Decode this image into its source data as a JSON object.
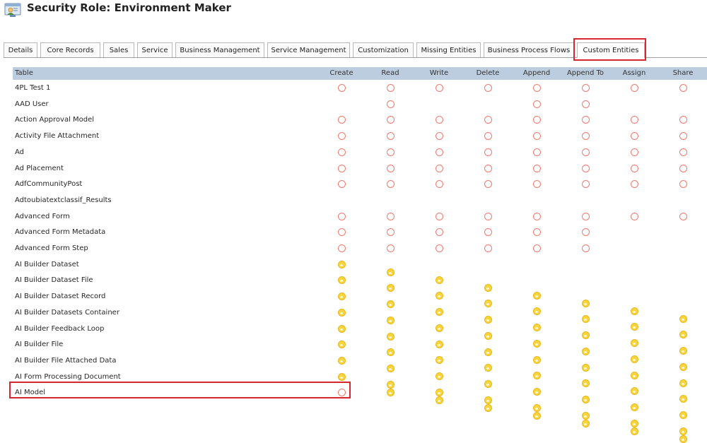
{
  "page": {
    "title": "Security Role: Environment Maker",
    "icon": "security-role-icon"
  },
  "tabs": [
    {
      "label": "Details",
      "active": false
    },
    {
      "label": "Core Records",
      "active": false
    },
    {
      "label": "Sales",
      "active": false
    },
    {
      "label": "Service",
      "active": false
    },
    {
      "label": "Business Management",
      "active": false
    },
    {
      "label": "Service Management",
      "active": false
    },
    {
      "label": "Customization",
      "active": false
    },
    {
      "label": "Missing Entities",
      "active": false
    },
    {
      "label": "Business Process Flows",
      "active": false
    },
    {
      "label": "Custom Entities",
      "active": true
    }
  ],
  "table": {
    "columns": [
      "Table",
      "Create",
      "Read",
      "Write",
      "Delete",
      "Append",
      "Append To",
      "Assign",
      "Share"
    ],
    "privilege_legend": {
      "n": "none",
      "e": "user-level (empty circle)",
      "o": "organization-level (yellow filled circle)"
    },
    "rows": [
      {
        "name": "4PL Test 1",
        "privileges": [
          "e",
          "e",
          "e",
          "e",
          "e",
          "e",
          "e",
          "e"
        ]
      },
      {
        "name": "AAD User",
        "privileges": [
          "n",
          "e",
          "n",
          "n",
          "e",
          "e",
          "n",
          "n"
        ]
      },
      {
        "name": "Action Approval Model",
        "privileges": [
          "e",
          "e",
          "e",
          "e",
          "e",
          "e",
          "e",
          "e"
        ]
      },
      {
        "name": "Activity File Attachment",
        "privileges": [
          "e",
          "e",
          "e",
          "e",
          "e",
          "e",
          "e",
          "e"
        ]
      },
      {
        "name": "Ad",
        "privileges": [
          "e",
          "e",
          "e",
          "e",
          "e",
          "e",
          "e",
          "e"
        ]
      },
      {
        "name": "Ad Placement",
        "privileges": [
          "e",
          "e",
          "e",
          "e",
          "e",
          "e",
          "e",
          "e"
        ]
      },
      {
        "name": "AdfCommunityPost",
        "privileges": [
          "e",
          "e",
          "e",
          "e",
          "e",
          "e",
          "e",
          "e"
        ]
      },
      {
        "name": "Adtoubiatextclassif_Results",
        "privileges": [
          "n",
          "n",
          "n",
          "n",
          "n",
          "n",
          "n",
          "n"
        ]
      },
      {
        "name": "Advanced Form",
        "privileges": [
          "e",
          "e",
          "e",
          "e",
          "e",
          "e",
          "e",
          "e"
        ]
      },
      {
        "name": "Advanced Form Metadata",
        "privileges": [
          "e",
          "e",
          "e",
          "e",
          "e",
          "e",
          "n",
          "n"
        ]
      },
      {
        "name": "Advanced Form Step",
        "privileges": [
          "e",
          "e",
          "e",
          "e",
          "e",
          "e",
          "n",
          "n"
        ]
      },
      {
        "name": "AI Builder Dataset",
        "privileges": [
          "o",
          "o",
          "o",
          "o",
          "o",
          "o",
          "o",
          "o"
        ]
      },
      {
        "name": "AI Builder Dataset File",
        "privileges": [
          "o",
          "o",
          "o",
          "o",
          "o",
          "o",
          "o",
          "o"
        ]
      },
      {
        "name": "AI Builder Dataset Record",
        "privileges": [
          "o",
          "o",
          "o",
          "o",
          "o",
          "o",
          "o",
          "o"
        ]
      },
      {
        "name": "AI Builder Datasets Container",
        "privileges": [
          "o",
          "o",
          "o",
          "o",
          "o",
          "o",
          "o",
          "o"
        ]
      },
      {
        "name": "AI Builder Feedback Loop",
        "privileges": [
          "o",
          "o",
          "o",
          "o",
          "o",
          "o",
          "o",
          "o"
        ]
      },
      {
        "name": "AI Builder File",
        "privileges": [
          "o",
          "o",
          "o",
          "o",
          "o",
          "o",
          "o",
          "o"
        ]
      },
      {
        "name": "AI Builder File Attached Data",
        "privileges": [
          "o",
          "o",
          "o",
          "o",
          "o",
          "o",
          "o",
          "o"
        ]
      },
      {
        "name": "AI Form Processing Document",
        "privileges": [
          "o",
          "o",
          "o",
          "o",
          "o",
          "o",
          "o",
          "o"
        ]
      },
      {
        "name": "AI Model",
        "privileges": [
          "e",
          "o",
          "o",
          "o",
          "o",
          "o",
          "o",
          "o"
        ],
        "highlighted": true
      }
    ]
  },
  "colors": {
    "highlight_border": "#d8262e",
    "header_bg": "#bccde0",
    "empty_circle": "#f07a6e",
    "org_circle": "#f9d53d"
  }
}
